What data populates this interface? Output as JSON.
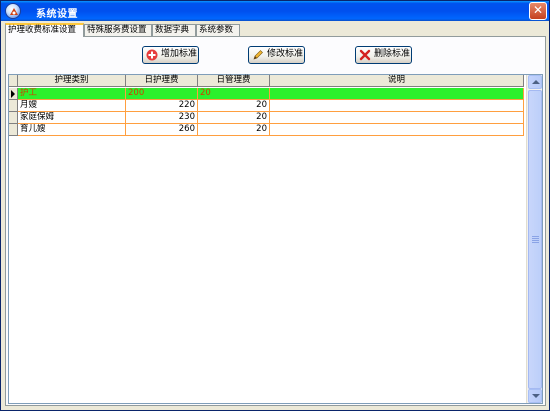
{
  "window": {
    "title": "系统设置",
    "close_symbol": "✕"
  },
  "tabs": [
    {
      "label": "护理收费标准设置",
      "active": true
    },
    {
      "label": "特殊服务费设置",
      "active": false
    },
    {
      "label": "数据字典",
      "active": false
    },
    {
      "label": "系统参数",
      "active": false
    }
  ],
  "toolbar": {
    "add_label": "增加标准",
    "edit_label": "修改标准",
    "delete_label": "删除标准"
  },
  "grid": {
    "columns": [
      "护理类别",
      "日护理费",
      "日管理费",
      "说明"
    ],
    "rows": [
      {
        "category": "护工",
        "daily_care_fee": "200",
        "daily_mgmt_fee": "20",
        "note": ""
      },
      {
        "category": "月嫂",
        "daily_care_fee": "220",
        "daily_mgmt_fee": "20",
        "note": ""
      },
      {
        "category": "家庭保姆",
        "daily_care_fee": "230",
        "daily_mgmt_fee": "20",
        "note": ""
      },
      {
        "category": "育儿嫂",
        "daily_care_fee": "260",
        "daily_mgmt_fee": "20",
        "note": ""
      }
    ],
    "selected_row": 0
  },
  "colors": {
    "selected_row_bg": "#2cf02c",
    "selected_row_text": "#d04000",
    "grid_line": "#ff9f3f",
    "titlebar": "#0053ee"
  }
}
